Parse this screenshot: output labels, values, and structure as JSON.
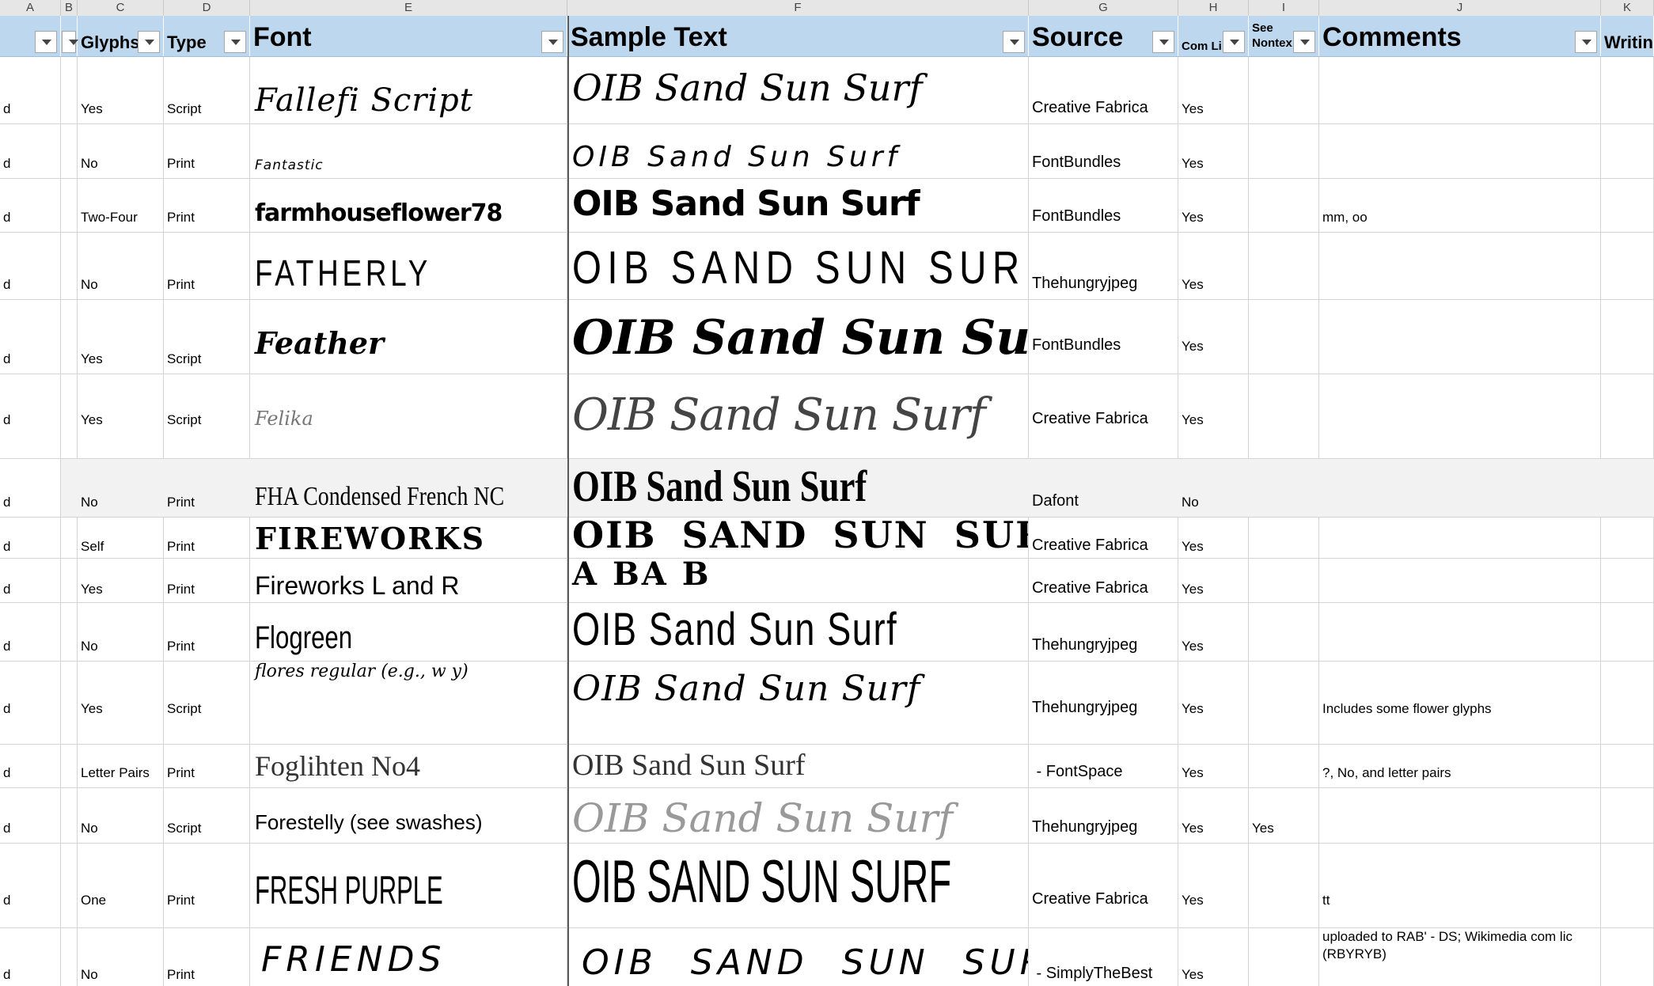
{
  "column_letters": [
    "A",
    "B",
    "C",
    "D",
    "E",
    "F",
    "G",
    "H",
    "I",
    "J",
    "K"
  ],
  "headers": {
    "a": "",
    "b": "",
    "glyphs": "Glyphs",
    "type": "Type",
    "font": "Font",
    "sample": "Sample Text",
    "source": "Source",
    "comlic": "Com Li",
    "seenontext_1": "See",
    "seenontext_2": "Nontex",
    "comments": "Comments",
    "writing": "Writin"
  },
  "rows": [
    {
      "a": "d",
      "glyphs": "Yes",
      "type": "Script",
      "font": "Fallefi Script",
      "sample": "OIB Sand Sun Surf",
      "source": "Creative Fabrica",
      "comlic": "Yes",
      "see": "",
      "comments": ""
    },
    {
      "a": "d",
      "glyphs": "No",
      "type": "Print",
      "font": "Fantastic",
      "sample": "OIB Sand Sun Surf",
      "source": "FontBundles",
      "comlic": "Yes",
      "see": "",
      "comments": ""
    },
    {
      "a": "d",
      "glyphs": "Two-Four",
      "type": "Print",
      "font": "farmhouseflower78",
      "sample": "OIB Sand Sun Surf",
      "source": "FontBundles",
      "comlic": "Yes",
      "see": "",
      "comments": "mm, oo"
    },
    {
      "a": "d",
      "glyphs": "No",
      "type": "Print",
      "font": "FATHERLY",
      "sample": "OIB SAND SUN SURF",
      "source": "Thehungryjpeg",
      "comlic": "Yes",
      "see": "",
      "comments": ""
    },
    {
      "a": "d",
      "glyphs": "Yes",
      "type": "Script",
      "font": "Feather",
      "sample": "OIB Sand Sun Surf",
      "source": "FontBundles",
      "comlic": "Yes",
      "see": "",
      "comments": ""
    },
    {
      "a": "d",
      "glyphs": "Yes",
      "type": "Script",
      "font": "Felika",
      "sample": "OIB Sand Sun Surf",
      "source": "Creative Fabrica",
      "comlic": "Yes",
      "see": "",
      "comments": ""
    },
    {
      "a": "d",
      "glyphs": "No",
      "type": "Print",
      "font": "FHA Condensed French NC",
      "sample": "OIB Sand Sun Surf",
      "source": "Dafont",
      "comlic": "No",
      "see": "",
      "comments": ""
    },
    {
      "a": "d",
      "glyphs": "Self",
      "type": "Print",
      "font": "FIREWORKS",
      "sample": "OIB SAND SUN SURF",
      "source": "Creative Fabrica",
      "comlic": "Yes",
      "see": "",
      "comments": ""
    },
    {
      "a": "d",
      "glyphs": "Yes",
      "type": "Print",
      "font": "Fireworks L and R",
      "sample": "A BA B",
      "source": "Creative Fabrica",
      "comlic": "Yes",
      "see": "",
      "comments": ""
    },
    {
      "a": "d",
      "glyphs": "No",
      "type": "Print",
      "font": "Flogreen",
      "sample": "OIB Sand Sun Surf",
      "source": "Thehungryjpeg",
      "comlic": "Yes",
      "see": "",
      "comments": ""
    },
    {
      "a": "d",
      "glyphs": "Yes",
      "type": "Script",
      "font": "flores regular (e.g., w y)",
      "sample": "OIB Sand Sun Surf",
      "source": "Thehungryjpeg",
      "comlic": "Yes",
      "see": "",
      "comments": "Includes some flower glyphs"
    },
    {
      "a": "d",
      "glyphs": "Letter Pairs",
      "type": "Print",
      "font": "Foglihten No4",
      "sample": "OIB Sand Sun Surf",
      "source": " - FontSpace",
      "comlic": "Yes",
      "see": "",
      "comments": "?, No, and letter pairs"
    },
    {
      "a": "d",
      "glyphs": "No",
      "type": "Script",
      "font": "Forestelly (see swashes)",
      "sample": "OIB Sand Sun Surf",
      "source": "Thehungryjpeg",
      "comlic": "Yes",
      "see": "Yes",
      "comments": ""
    },
    {
      "a": "d",
      "glyphs": "One",
      "type": "Print",
      "font": "FRESH PURPLE",
      "sample": "OIB SAND SUN SURF",
      "source": "Creative Fabrica",
      "comlic": "Yes",
      "see": "",
      "comments": "tt"
    },
    {
      "a": "d",
      "glyphs": "No",
      "type": "Print",
      "font": "FRIENDS",
      "sample": "OIB SAND SUN SURF",
      "source": " - SimplyTheBest",
      "comlic": "Yes",
      "see": "",
      "comments": "uploaded to RAB' - DS; Wikimedia com lic (RBYRYB)"
    }
  ]
}
